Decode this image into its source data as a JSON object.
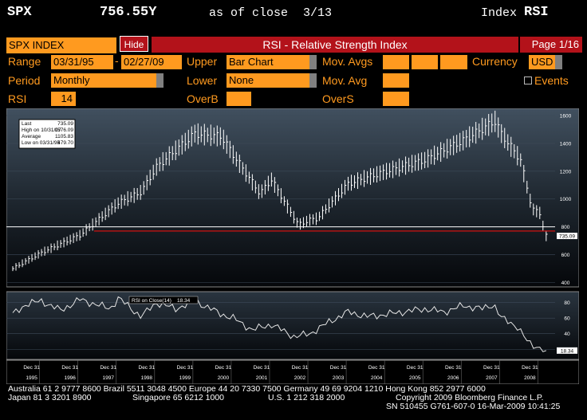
{
  "header": {
    "ticker": "SPX",
    "price": "756.55Y",
    "asof": "as of close",
    "date": "3/13",
    "index_label": "Index",
    "function": "RSI"
  },
  "titlebar": {
    "security": "SPX INDEX",
    "hide_label": "Hide",
    "title": "RSI - Relative Strength Index",
    "page": "Page 1/16"
  },
  "controls": {
    "range_label": "Range",
    "range_start": "03/31/95",
    "range_sep": "-",
    "range_end": "02/27/09",
    "upper_label": "Upper",
    "upper_value": "Bar Chart",
    "movavgs_label": "Mov. Avgs",
    "currency_label": "Currency",
    "currency_value": "USD",
    "period_label": "Period",
    "period_value": "Monthly",
    "lower_label": "Lower",
    "lower_value": "None",
    "movavg_label": "Mov. Avg",
    "events_label": "Events",
    "events_checked": false,
    "rsi_label": "RSI",
    "rsi_value": "14",
    "overb_label": "OverB",
    "overs_label": "OverS"
  },
  "stats": {
    "last_label": "Last",
    "last_value": "735.09",
    "high_label": "High on 10/31/07",
    "high_value": "1576.09",
    "avg_label": "Average",
    "avg_value": "1105.83",
    "low_label": "Low on 03/31/95",
    "low_value": "479.70"
  },
  "chart_data": [
    {
      "type": "bar",
      "title": "",
      "x_start": "1995-03",
      "x_end": "2009-02",
      "y_ticks": [
        400,
        600,
        800,
        1000,
        1200,
        1400,
        1600
      ],
      "ylim": [
        380,
        1640
      ],
      "last_label": "735.09",
      "reference_lines": [
        800,
        770
      ],
      "monthly_close_anchors": [
        [
          1995.25,
          500
        ],
        [
          1996.0,
          615
        ],
        [
          1997.0,
          740
        ],
        [
          1998.0,
          970
        ],
        [
          1998.6,
          1050
        ],
        [
          1999.0,
          1230
        ],
        [
          2000.0,
          1470
        ],
        [
          2000.7,
          1450
        ],
        [
          2001.0,
          1320
        ],
        [
          2001.7,
          1040
        ],
        [
          2002.0,
          1140
        ],
        [
          2002.7,
          815
        ],
        [
          2003.0,
          850
        ],
        [
          2003.2,
          860
        ],
        [
          2004.0,
          1110
        ],
        [
          2005.0,
          1200
        ],
        [
          2006.0,
          1280
        ],
        [
          2007.0,
          1420
        ],
        [
          2007.83,
          1560
        ],
        [
          2008.0,
          1470
        ],
        [
          2008.5,
          1280
        ],
        [
          2008.8,
          930
        ],
        [
          2009.0,
          900
        ],
        [
          2009.15,
          735
        ]
      ]
    },
    {
      "type": "line",
      "series": [
        {
          "name": "RSI on Close(14)",
          "last": "18.34"
        }
      ],
      "y_ticks": [
        20,
        40,
        60,
        80
      ],
      "ylim": [
        10,
        92
      ],
      "last_label": "18.34",
      "anchors": [
        [
          1995.25,
          65
        ],
        [
          1995.6,
          78
        ],
        [
          1996.0,
          82
        ],
        [
          1996.5,
          70
        ],
        [
          1997.0,
          84
        ],
        [
          1997.8,
          72
        ],
        [
          1998.0,
          86
        ],
        [
          1998.6,
          62
        ],
        [
          1999.0,
          80
        ],
        [
          1999.5,
          72
        ],
        [
          2000.0,
          82
        ],
        [
          2000.7,
          65
        ],
        [
          2001.0,
          60
        ],
        [
          2001.5,
          45
        ],
        [
          2002.0,
          52
        ],
        [
          2002.6,
          36
        ],
        [
          2003.0,
          40
        ],
        [
          2003.5,
          55
        ],
        [
          2004.0,
          68
        ],
        [
          2004.5,
          62
        ],
        [
          2005.0,
          65
        ],
        [
          2006.0,
          72
        ],
        [
          2006.5,
          68
        ],
        [
          2007.0,
          76
        ],
        [
          2007.5,
          72
        ],
        [
          2007.8,
          78
        ],
        [
          2008.0,
          60
        ],
        [
          2008.4,
          50
        ],
        [
          2008.7,
          28
        ],
        [
          2009.0,
          22
        ],
        [
          2009.15,
          18.34
        ]
      ]
    }
  ],
  "x_axis": {
    "month_label": "Dec 31",
    "years": [
      "1995",
      "1996",
      "1997",
      "1998",
      "1999",
      "2000",
      "2001",
      "2002",
      "2003",
      "2004",
      "2005",
      "2006",
      "2007",
      "2008"
    ]
  },
  "footer": {
    "line1": "Australia 61 2 9777 8600 Brazil 5511 3048 4500 Europe 44 20 7330 7500 Germany 49 69 9204 1210 Hong Kong 852 2977 6000",
    "line2_left": "Japan 81 3 3201 8900",
    "line2_mid": "Singapore 65 6212 1000",
    "line2_right": "U.S. 1 212 318 2000",
    "line2_copy": "Copyright 2009 Bloomberg Finance L.P.",
    "line3": "SN 510455 G761-607-0 16-Mar-2009 10:41:25"
  },
  "colors": {
    "accent": "#ff9a1f",
    "bar": "#b3121a",
    "ref_line": "#d01010"
  }
}
